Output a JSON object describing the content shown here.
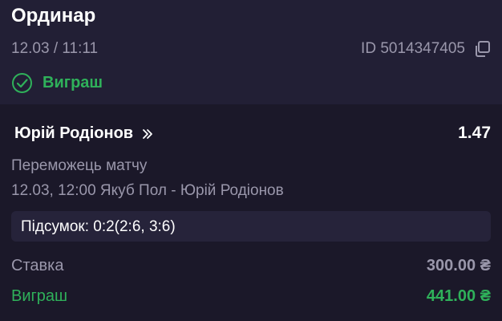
{
  "bet": {
    "type_title": "Ординар",
    "datetime": "12.03 / 11:11",
    "id_text": "ID 5014347405",
    "status": "Виграш",
    "status_icon": "check-circle-icon",
    "copy_icon": "copy-icon"
  },
  "event": {
    "selection": "Юрій Родіонов",
    "selection_icon": "double-chevron-right-icon",
    "odds": "1.47",
    "market": "Переможець матчу",
    "match": "12.03, 12:00 Якуб Пол - Юрій Родіонов",
    "result": "Підсумок: 0:2(2:6, 3:6)"
  },
  "summary": {
    "stake_label": "Ставка",
    "stake_value": "300.00 ₴",
    "win_label": "Виграш",
    "win_value": "441.00 ₴"
  },
  "colors": {
    "background": "#1b1829",
    "header_background": "#221f35",
    "muted_text": "#9a97ab",
    "win_green": "#2fb15a",
    "result_box": "#26233a"
  }
}
